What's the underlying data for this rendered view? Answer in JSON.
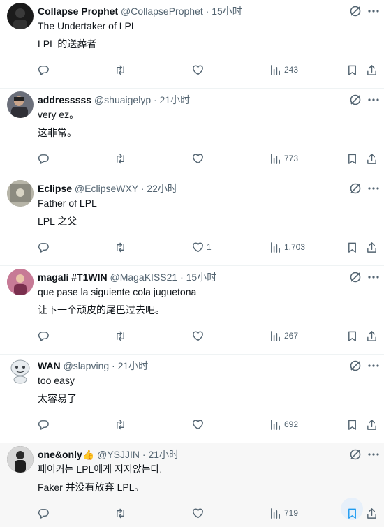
{
  "tweets": [
    {
      "name": "Collapse Prophet",
      "handle": "@CollapseProphet",
      "time": "· 15小时",
      "line1": "The Undertaker of LPL",
      "line2": "LPL 的送葬者",
      "likes": "",
      "views": "243",
      "avatar_color": "#1b1b1b"
    },
    {
      "name": "addresssss",
      "handle": "@shuaigelyp",
      "time": "· 21小时",
      "line1": "very ez。",
      "line2": "这非常。",
      "likes": "",
      "views": "773",
      "avatar_color": "#6b6f7a"
    },
    {
      "name": "Eclipse",
      "handle": "@EclipseWXY",
      "time": "· 22小时",
      "line1": "Father of LPL",
      "line2": "LPL 之父",
      "likes": "1",
      "views": "1,703",
      "avatar_color": "#9a9a8f"
    },
    {
      "name": "magalí #T1WIN",
      "handle": "@MagaKISS21",
      "time": "· 15小时",
      "line1": "que pase la siguiente cola juguetona",
      "line2": "让下一个顽皮的尾巴过去吧。",
      "likes": "",
      "views": "267",
      "avatar_color": "#b05a7a"
    },
    {
      "name": "WAN",
      "handle": "@slapving",
      "time": "· 21小时",
      "line1": "too easy",
      "line2": "太容易了",
      "likes": "",
      "views": "692",
      "avatar_color": "#e8ecef"
    },
    {
      "name": "one&only👍",
      "handle": "@YSJJIN",
      "time": "· 21小时",
      "line1": "페이커는 LPL에게 지지않는다.",
      "line2": "Faker 并没有放弃 LPL。",
      "likes": "",
      "views": "719",
      "avatar_color": "#2a2a2a"
    }
  ],
  "colors": {
    "secondary_text": "#536471",
    "accent": "#1d9bf0",
    "hover_bg": "#f7f7f7"
  },
  "icons": [
    "reply-icon",
    "retweet-icon",
    "like-icon",
    "views-icon",
    "bookmark-icon",
    "share-icon",
    "grok-icon",
    "more-icon"
  ]
}
